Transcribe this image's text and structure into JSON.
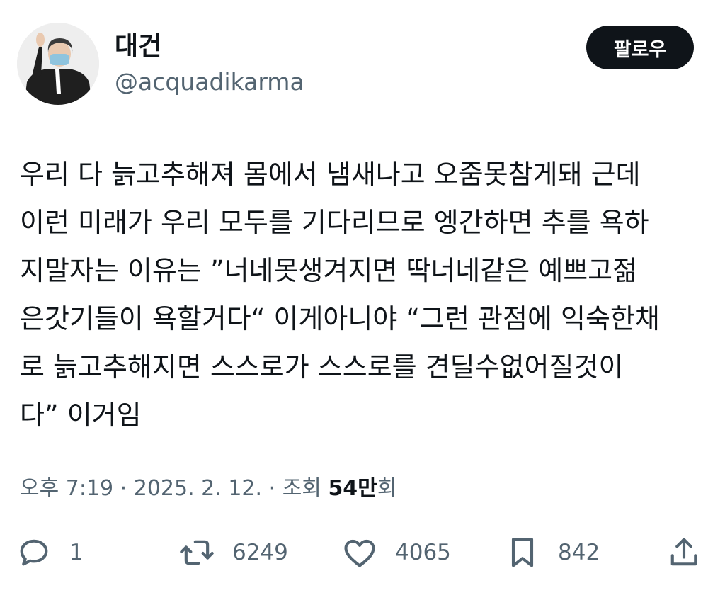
{
  "author": {
    "display_name": "대건",
    "handle": "@acquadikarma",
    "avatar_icon": "avatar-photo-icon"
  },
  "follow_button": {
    "label": "팔로우"
  },
  "tweet": {
    "lines": [
      "우리 다 늙고추해져 몸에서 냄새나고 오줌못참게돼 근데",
      "이런 미래가 우리 모두를 기다리므로 엥간하면 추를 욕하",
      "지말자는 이유는 ”너네못생겨지면 딱너네같은 예쁘고젊",
      "은갓기들이 욕할거다“ 이게아니야 “그런 관점에 익숙한채",
      "로 늙고추해지면 스스로가 스스로를 견딜수없어질것이",
      "다” 이거임"
    ]
  },
  "meta": {
    "time": "오후 7:19",
    "separator": "·",
    "date": "2025. 2. 12.",
    "views_label": "조회",
    "views_number": "54만",
    "views_suffix": "회"
  },
  "actions": {
    "reply": {
      "icon": "reply-icon",
      "count": "1"
    },
    "retweet": {
      "icon": "retweet-icon",
      "count": "6249"
    },
    "like": {
      "icon": "heart-icon",
      "count": "4065"
    },
    "bookmark": {
      "icon": "bookmark-icon",
      "count": "842"
    },
    "share": {
      "icon": "share-icon"
    }
  },
  "colors": {
    "text_primary": "#0f1419",
    "text_secondary": "#536471",
    "button_bg": "#0f1419",
    "button_text": "#ffffff"
  }
}
